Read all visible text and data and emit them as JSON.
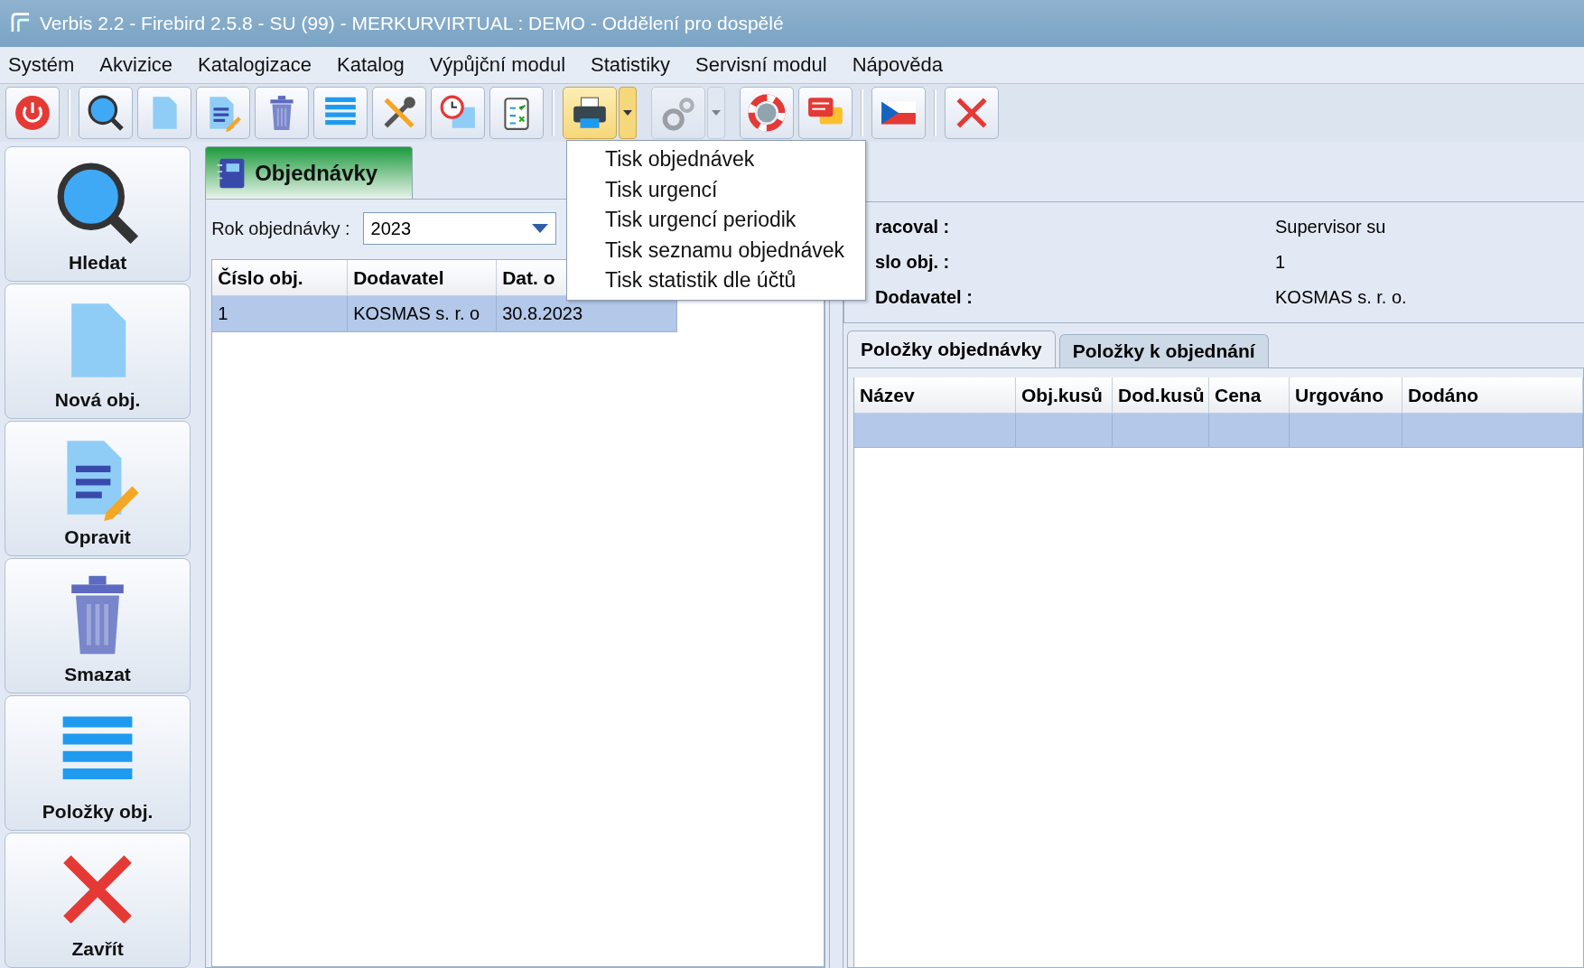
{
  "window": {
    "title": "Verbis 2.2 - Firebird 2.5.8 - SU (99) - MERKURVIRTUAL : DEMO - Oddělení pro dospělé"
  },
  "menu": [
    "Systém",
    "Akvizice",
    "Katalogizace",
    "Katalog",
    "Výpůjční modul",
    "Statistiky",
    "Servisní modul",
    "Nápověda"
  ],
  "toolbar": [
    {
      "kind": "button",
      "pressed": false,
      "disabled": false
    },
    {
      "kind": "separator"
    },
    {
      "kind": "button",
      "pressed": false,
      "disabled": false
    },
    {
      "kind": "button",
      "pressed": false,
      "disabled": false
    },
    {
      "kind": "button",
      "pressed": false,
      "disabled": false
    },
    {
      "kind": "button",
      "pressed": false,
      "disabled": false
    },
    {
      "kind": "button",
      "pressed": false,
      "disabled": false
    },
    {
      "kind": "button",
      "pressed": false,
      "disabled": false
    },
    {
      "kind": "button",
      "pressed": false,
      "disabled": false
    },
    {
      "kind": "button",
      "pressed": false,
      "disabled": false
    },
    {
      "kind": "separator"
    },
    {
      "kind": "split",
      "pressed": true,
      "disabled": false
    },
    {
      "kind": "split",
      "pressed": false,
      "disabled": true
    },
    {
      "kind": "button",
      "pressed": false,
      "disabled": false
    },
    {
      "kind": "button",
      "pressed": false,
      "disabled": false
    },
    {
      "kind": "separator"
    },
    {
      "kind": "button",
      "pressed": false,
      "disabled": false
    },
    {
      "kind": "separator"
    },
    {
      "kind": "button",
      "pressed": false,
      "disabled": false
    }
  ],
  "sidebar": [
    "Hledat",
    "Nová obj.",
    "Opravit",
    "Smazat",
    "Položky obj.",
    "Zavřít"
  ],
  "left_panel": {
    "tab": "Objednávky",
    "year_label": "Rok objednávky :",
    "year_value": "2023",
    "table": {
      "columns": [
        "Číslo obj.",
        "Dodavatel",
        "Dat. o"
      ],
      "rows": [
        {
          "cells": [
            "1",
            "KOSMAS s. r. o",
            "30.8.2023"
          ],
          "selected": true
        }
      ]
    }
  },
  "print_menu": [
    "Tisk objednávek",
    "Tisk urgencí",
    "Tisk urgencí periodik",
    "Tisk seznamu objednávek",
    "Tisk statistik dle účtů"
  ],
  "right_panel": {
    "details": [
      {
        "label": "racoval :",
        "value": "Supervisor su"
      },
      {
        "label": "slo obj. :",
        "value": "1"
      },
      {
        "label": "Dodavatel :",
        "value": "KOSMAS s. r. o."
      }
    ],
    "tabs": [
      {
        "label": "Položky objednávky",
        "selected": true
      },
      {
        "label": "Položky k objednání",
        "selected": false
      }
    ],
    "grid": {
      "columns": [
        "Název",
        "Obj.kusů",
        "Dod.kusů",
        "Cena",
        "Urgováno",
        "Dodáno"
      ],
      "rows": [
        {
          "selected": true
        }
      ]
    }
  }
}
